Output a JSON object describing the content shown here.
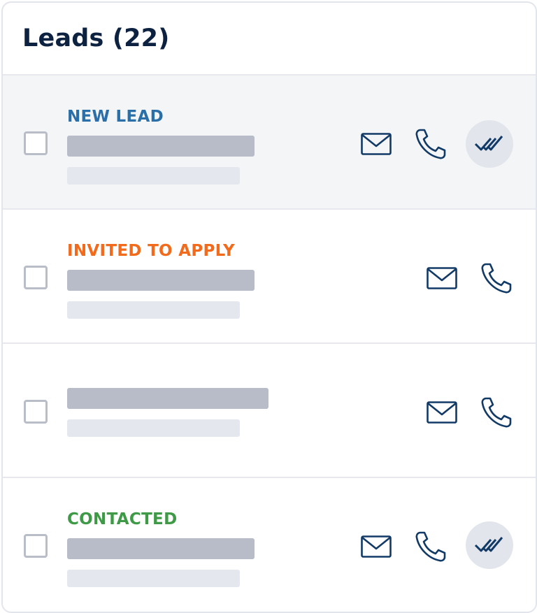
{
  "header": {
    "title": "Leads (22)"
  },
  "colors": {
    "new_lead": "#2a6fa8",
    "invited": "#f26a1b",
    "contacted": "#3e9a47",
    "icon_navy": "#123a66"
  },
  "leads": [
    {
      "status": "NEW LEAD",
      "status_color": "#2a6fa8",
      "highlighted": true,
      "actions": [
        "envelope-icon",
        "phone-icon",
        "double-check-icon"
      ]
    },
    {
      "status": "INVITED TO APPLY",
      "status_color": "#f26a1b",
      "highlighted": false,
      "actions": [
        "envelope-icon",
        "phone-icon"
      ]
    },
    {
      "status": "",
      "status_color": "",
      "highlighted": false,
      "actions": [
        "envelope-icon",
        "phone-icon"
      ]
    },
    {
      "status": "CONTACTED",
      "status_color": "#3e9a47",
      "highlighted": false,
      "actions": [
        "envelope-icon",
        "phone-icon",
        "double-check-icon"
      ]
    }
  ]
}
